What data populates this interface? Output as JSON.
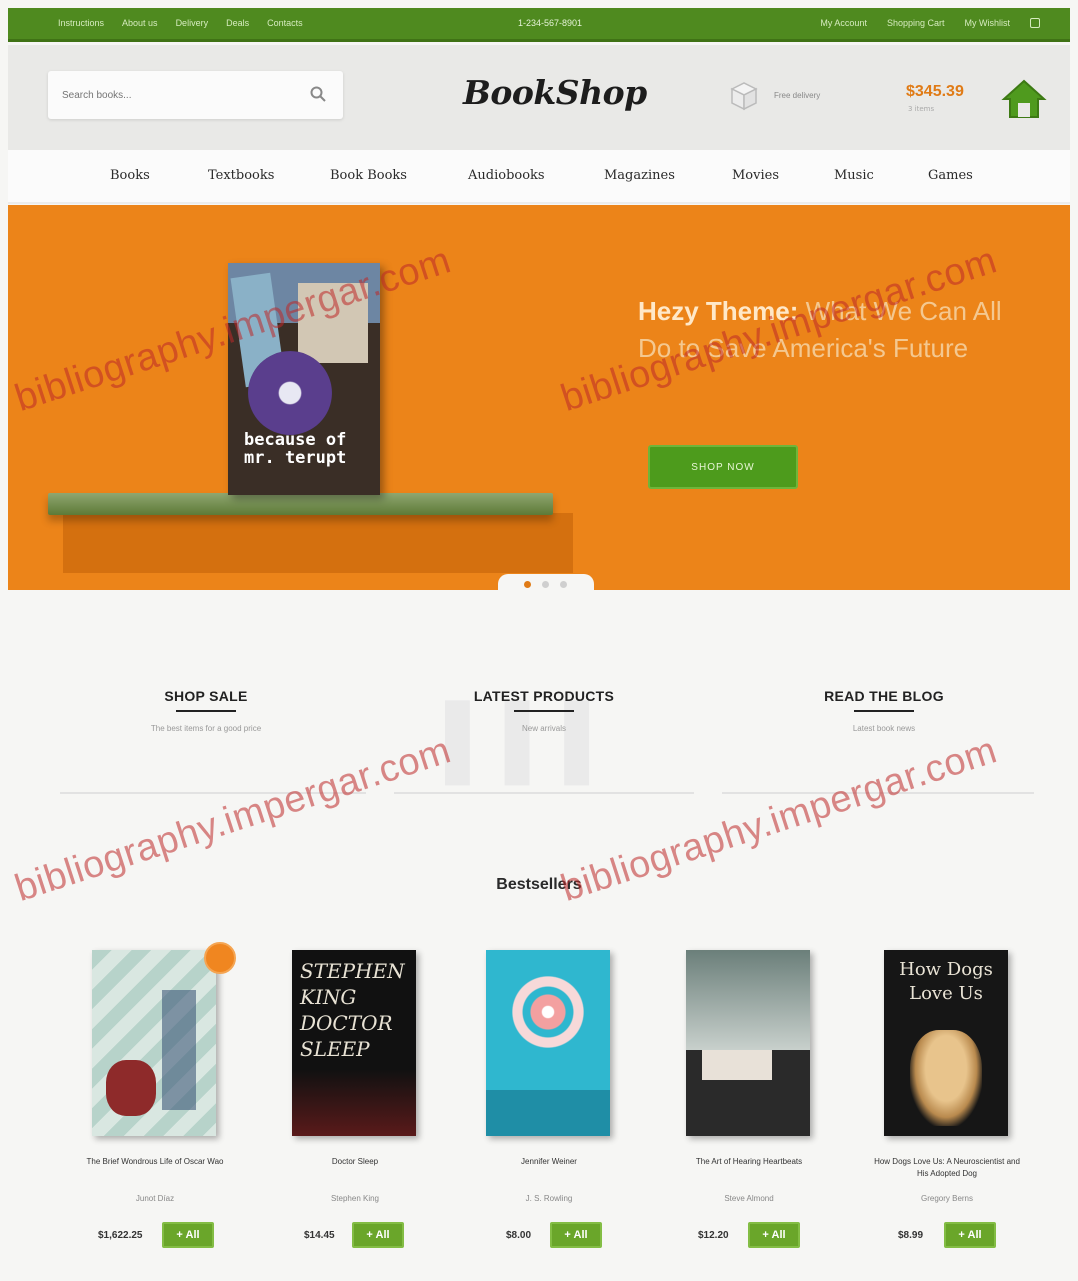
{
  "topbar": {
    "links": [
      "Instructions",
      "About us",
      "Delivery",
      "Deals",
      "Contacts"
    ],
    "phone": "1-234-567-8901",
    "right_links": [
      "My Account",
      "Shopping Cart",
      "My Wishlist"
    ]
  },
  "header": {
    "search_placeholder": "Search books...",
    "logo": "BookShop",
    "delivery_text": "Free delivery",
    "cart_total": "$345.39",
    "cart_items": "3 items"
  },
  "nav": {
    "items": [
      "Books",
      "Textbooks",
      "Book Books",
      "Audiobooks",
      "Magazines",
      "Movies",
      "Music",
      "Games"
    ]
  },
  "hero": {
    "book_title": "because of mr. terupt",
    "headline_bold": "Hezy Theme:",
    "headline_rest": " What We Can All Do to Save America's Future",
    "button_label": "SHOP NOW"
  },
  "features": [
    {
      "title": "SHOP SALE",
      "subtitle": "The best items for a good price"
    },
    {
      "title": "LATEST PRODUCTS",
      "subtitle": "New arrivals"
    },
    {
      "title": "READ THE BLOG",
      "subtitle": "Latest book news"
    }
  ],
  "bestsellers": {
    "title": "Bestsellers",
    "products": [
      {
        "title": "The Brief Wondrous Life of Oscar Wao",
        "author": "Junot Díaz",
        "price": "$1,622.25",
        "button": "+ All"
      },
      {
        "title": "Doctor Sleep",
        "author": "Stephen King",
        "price": "$14.45",
        "button": "+ All"
      },
      {
        "title": "Jennifer Weiner",
        "author": "J. S. Rowling",
        "price": "$8.00",
        "button": "+ All"
      },
      {
        "title": "The Art of Hearing Heartbeats",
        "author": "Steve Almond",
        "price": "$12.20",
        "button": "+ All"
      },
      {
        "title": "How Dogs Love Us: A Neuroscientist and His Adopted Dog",
        "author": "Gregory Berns",
        "price": "$8.99",
        "button": "+ All"
      }
    ]
  },
  "watermark": "bibliography.impergar.com",
  "colors": {
    "brand_green": "#4f8a1f",
    "hero_orange": "#ec8419",
    "price_orange": "#e07b16",
    "button_green": "#6aa62a"
  }
}
